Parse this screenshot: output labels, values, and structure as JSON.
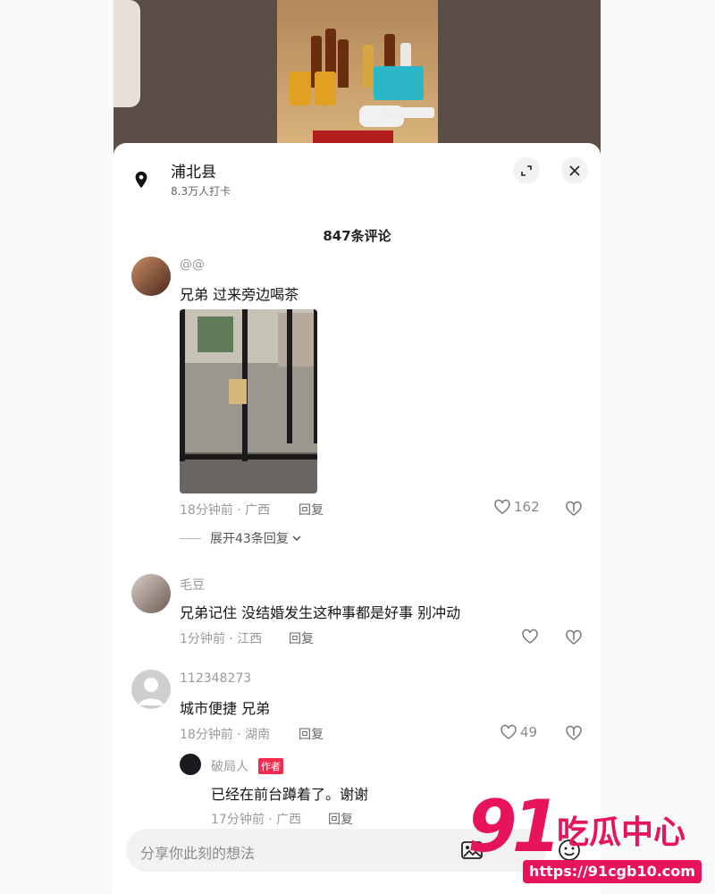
{
  "location": {
    "name": "浦北县",
    "subtitle": "8.3万人打卡"
  },
  "comments_count": "847条评论",
  "comments": [
    {
      "user": "@@",
      "text": "兄弟 过来旁边喝茶",
      "meta": "18分钟前 · 广西",
      "reply": "回复",
      "likes": "162",
      "expand": "展开43条回复"
    },
    {
      "user": "毛豆",
      "text": "兄弟记住 没结婚发生这种事都是好事 别冲动",
      "meta": "1分钟前 · 江西",
      "reply": "回复",
      "likes": ""
    },
    {
      "user": "112348273",
      "text": "城市便捷 兄弟",
      "meta": "18分钟前 · 湖南",
      "reply": "回复",
      "likes": "49"
    }
  ],
  "sub_reply": {
    "user": "破局人",
    "badge": "作者",
    "text": "已经在前台蹲着了。谢谢",
    "meta": "17分钟前 · 广西",
    "reply": "回复"
  },
  "input": {
    "placeholder": "分享你此刻的想法"
  },
  "watermark": {
    "num": "91",
    "text": "吃瓜中心",
    "url": "https://91cgb10.com"
  },
  "colors": {
    "accent": "#e8145b",
    "badge": "#f52a4f"
  }
}
